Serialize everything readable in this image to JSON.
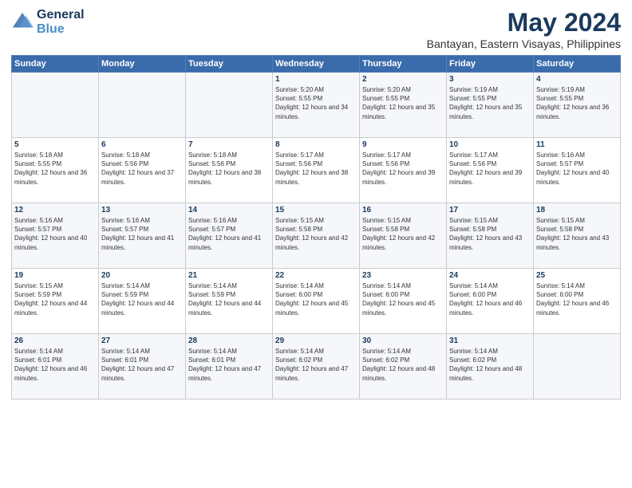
{
  "logo": {
    "line1": "General",
    "line2": "Blue"
  },
  "title": "May 2024",
  "subtitle": "Bantayan, Eastern Visayas, Philippines",
  "weekdays": [
    "Sunday",
    "Monday",
    "Tuesday",
    "Wednesday",
    "Thursday",
    "Friday",
    "Saturday"
  ],
  "weeks": [
    [
      {
        "day": "",
        "sunrise": "",
        "sunset": "",
        "daylight": ""
      },
      {
        "day": "",
        "sunrise": "",
        "sunset": "",
        "daylight": ""
      },
      {
        "day": "",
        "sunrise": "",
        "sunset": "",
        "daylight": ""
      },
      {
        "day": "1",
        "sunrise": "Sunrise: 5:20 AM",
        "sunset": "Sunset: 5:55 PM",
        "daylight": "Daylight: 12 hours and 34 minutes."
      },
      {
        "day": "2",
        "sunrise": "Sunrise: 5:20 AM",
        "sunset": "Sunset: 5:55 PM",
        "daylight": "Daylight: 12 hours and 35 minutes."
      },
      {
        "day": "3",
        "sunrise": "Sunrise: 5:19 AM",
        "sunset": "Sunset: 5:55 PM",
        "daylight": "Daylight: 12 hours and 35 minutes."
      },
      {
        "day": "4",
        "sunrise": "Sunrise: 5:19 AM",
        "sunset": "Sunset: 5:55 PM",
        "daylight": "Daylight: 12 hours and 36 minutes."
      }
    ],
    [
      {
        "day": "5",
        "sunrise": "Sunrise: 5:18 AM",
        "sunset": "Sunset: 5:55 PM",
        "daylight": "Daylight: 12 hours and 36 minutes."
      },
      {
        "day": "6",
        "sunrise": "Sunrise: 5:18 AM",
        "sunset": "Sunset: 5:56 PM",
        "daylight": "Daylight: 12 hours and 37 minutes."
      },
      {
        "day": "7",
        "sunrise": "Sunrise: 5:18 AM",
        "sunset": "Sunset: 5:56 PM",
        "daylight": "Daylight: 12 hours and 38 minutes."
      },
      {
        "day": "8",
        "sunrise": "Sunrise: 5:17 AM",
        "sunset": "Sunset: 5:56 PM",
        "daylight": "Daylight: 12 hours and 38 minutes."
      },
      {
        "day": "9",
        "sunrise": "Sunrise: 5:17 AM",
        "sunset": "Sunset: 5:56 PM",
        "daylight": "Daylight: 12 hours and 39 minutes."
      },
      {
        "day": "10",
        "sunrise": "Sunrise: 5:17 AM",
        "sunset": "Sunset: 5:56 PM",
        "daylight": "Daylight: 12 hours and 39 minutes."
      },
      {
        "day": "11",
        "sunrise": "Sunrise: 5:16 AM",
        "sunset": "Sunset: 5:57 PM",
        "daylight": "Daylight: 12 hours and 40 minutes."
      }
    ],
    [
      {
        "day": "12",
        "sunrise": "Sunrise: 5:16 AM",
        "sunset": "Sunset: 5:57 PM",
        "daylight": "Daylight: 12 hours and 40 minutes."
      },
      {
        "day": "13",
        "sunrise": "Sunrise: 5:16 AM",
        "sunset": "Sunset: 5:57 PM",
        "daylight": "Daylight: 12 hours and 41 minutes."
      },
      {
        "day": "14",
        "sunrise": "Sunrise: 5:16 AM",
        "sunset": "Sunset: 5:57 PM",
        "daylight": "Daylight: 12 hours and 41 minutes."
      },
      {
        "day": "15",
        "sunrise": "Sunrise: 5:15 AM",
        "sunset": "Sunset: 5:58 PM",
        "daylight": "Daylight: 12 hours and 42 minutes."
      },
      {
        "day": "16",
        "sunrise": "Sunrise: 5:15 AM",
        "sunset": "Sunset: 5:58 PM",
        "daylight": "Daylight: 12 hours and 42 minutes."
      },
      {
        "day": "17",
        "sunrise": "Sunrise: 5:15 AM",
        "sunset": "Sunset: 5:58 PM",
        "daylight": "Daylight: 12 hours and 43 minutes."
      },
      {
        "day": "18",
        "sunrise": "Sunrise: 5:15 AM",
        "sunset": "Sunset: 5:58 PM",
        "daylight": "Daylight: 12 hours and 43 minutes."
      }
    ],
    [
      {
        "day": "19",
        "sunrise": "Sunrise: 5:15 AM",
        "sunset": "Sunset: 5:59 PM",
        "daylight": "Daylight: 12 hours and 44 minutes."
      },
      {
        "day": "20",
        "sunrise": "Sunrise: 5:14 AM",
        "sunset": "Sunset: 5:59 PM",
        "daylight": "Daylight: 12 hours and 44 minutes."
      },
      {
        "day": "21",
        "sunrise": "Sunrise: 5:14 AM",
        "sunset": "Sunset: 5:59 PM",
        "daylight": "Daylight: 12 hours and 44 minutes."
      },
      {
        "day": "22",
        "sunrise": "Sunrise: 5:14 AM",
        "sunset": "Sunset: 6:00 PM",
        "daylight": "Daylight: 12 hours and 45 minutes."
      },
      {
        "day": "23",
        "sunrise": "Sunrise: 5:14 AM",
        "sunset": "Sunset: 6:00 PM",
        "daylight": "Daylight: 12 hours and 45 minutes."
      },
      {
        "day": "24",
        "sunrise": "Sunrise: 5:14 AM",
        "sunset": "Sunset: 6:00 PM",
        "daylight": "Daylight: 12 hours and 46 minutes."
      },
      {
        "day": "25",
        "sunrise": "Sunrise: 5:14 AM",
        "sunset": "Sunset: 6:00 PM",
        "daylight": "Daylight: 12 hours and 46 minutes."
      }
    ],
    [
      {
        "day": "26",
        "sunrise": "Sunrise: 5:14 AM",
        "sunset": "Sunset: 6:01 PM",
        "daylight": "Daylight: 12 hours and 46 minutes."
      },
      {
        "day": "27",
        "sunrise": "Sunrise: 5:14 AM",
        "sunset": "Sunset: 6:01 PM",
        "daylight": "Daylight: 12 hours and 47 minutes."
      },
      {
        "day": "28",
        "sunrise": "Sunrise: 5:14 AM",
        "sunset": "Sunset: 6:01 PM",
        "daylight": "Daylight: 12 hours and 47 minutes."
      },
      {
        "day": "29",
        "sunrise": "Sunrise: 5:14 AM",
        "sunset": "Sunset: 6:02 PM",
        "daylight": "Daylight: 12 hours and 47 minutes."
      },
      {
        "day": "30",
        "sunrise": "Sunrise: 5:14 AM",
        "sunset": "Sunset: 6:02 PM",
        "daylight": "Daylight: 12 hours and 48 minutes."
      },
      {
        "day": "31",
        "sunrise": "Sunrise: 5:14 AM",
        "sunset": "Sunset: 6:02 PM",
        "daylight": "Daylight: 12 hours and 48 minutes."
      },
      {
        "day": "",
        "sunrise": "",
        "sunset": "",
        "daylight": ""
      }
    ]
  ]
}
